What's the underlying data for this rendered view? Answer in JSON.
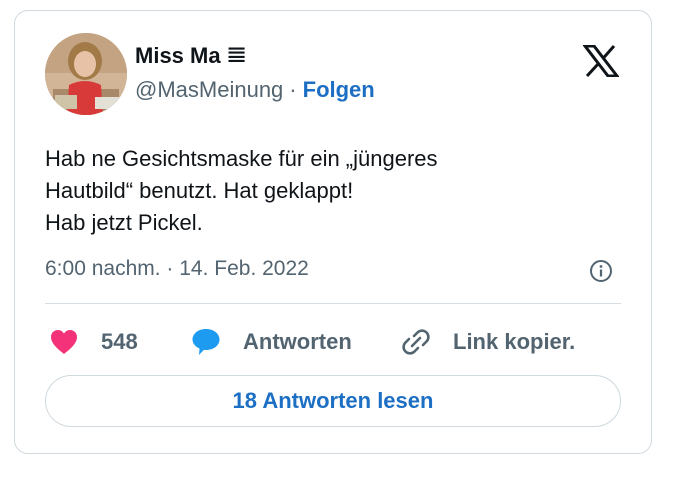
{
  "author": {
    "display_name": "Miss Ma",
    "name_glyph": "𝌆",
    "handle": "@MasMeinung",
    "separator": "·",
    "follow_label": "Folgen"
  },
  "tweet": {
    "lines": [
      "Hab ne Gesichtsmaske für ein „jüngeres",
      "Hautbild“ benutzt. Hat geklappt!",
      "Hab jetzt Pickel."
    ],
    "timestamp": "6:00 nachm. · 14. Feb. 2022"
  },
  "actions": {
    "like_count": "548",
    "reply_label": "Antworten",
    "copy_link_label": "Link kopier."
  },
  "read_replies_label": "18 Antworten lesen",
  "colors": {
    "like": "#f4327a",
    "reply": "#1d9bf0",
    "link_accent": "#1d6fc4",
    "muted_text": "#536471",
    "border": "#cfd9de"
  },
  "icons": {
    "brand": "x-logo-icon",
    "info": "info-icon",
    "like": "heart-icon",
    "reply": "speech-bubble-icon",
    "copy_link": "link-icon"
  }
}
